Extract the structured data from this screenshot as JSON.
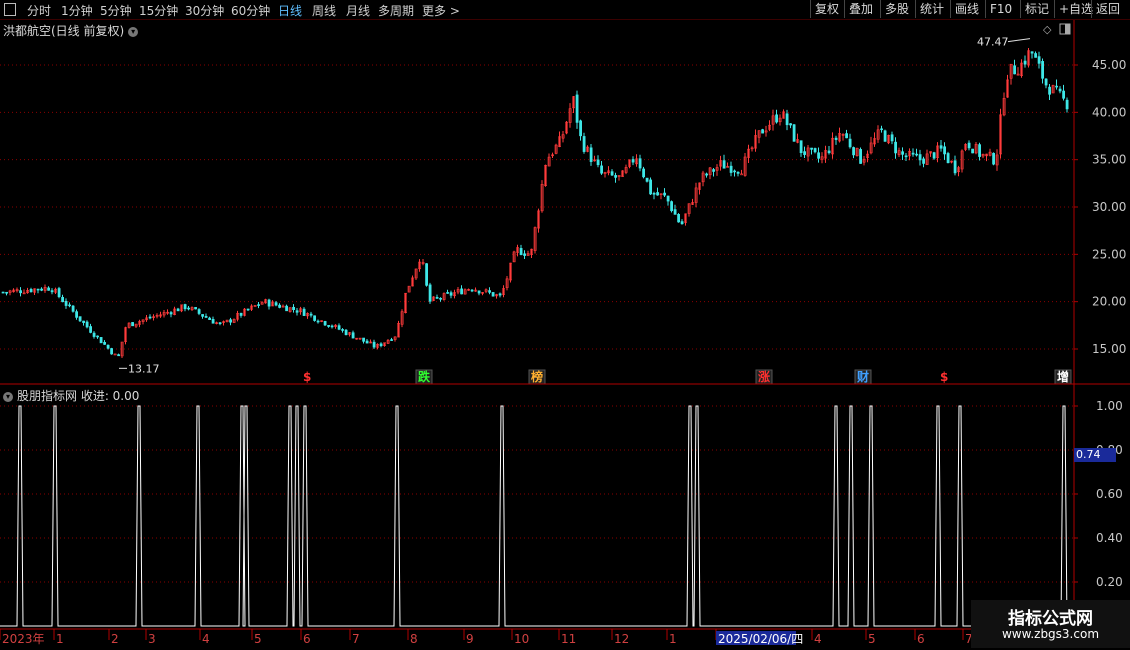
{
  "toolbar": {
    "left_items": [
      "分时",
      "1分钟",
      "5分钟",
      "15分钟",
      "30分钟",
      "60分钟",
      "日线",
      "周线",
      "月线",
      "多周期",
      "更多 >"
    ],
    "active_item": "日线",
    "right_items": [
      "复权",
      "叠加",
      "多股",
      "统计",
      "画线",
      "F10",
      "标记",
      "+自选",
      "返回"
    ]
  },
  "stock": {
    "title": "洪都航空(日线 前复权)"
  },
  "price_chart": {
    "high_label": "47.47",
    "low_label": "13.17",
    "y_ticks": [
      "45.00",
      "40.00",
      "35.00",
      "30.00",
      "25.00",
      "20.00",
      "15.00"
    ],
    "events": [
      {
        "label": "$",
        "color": "#ff3030"
      },
      {
        "label": "跌",
        "color": "#30ff30"
      },
      {
        "label": "榜",
        "color": "#ffb030"
      },
      {
        "label": "涨",
        "color": "#ff3030"
      },
      {
        "label": "财",
        "color": "#40a0ff"
      },
      {
        "label": "$",
        "color": "#ff3030"
      },
      {
        "label": "增",
        "color": "#ffffff"
      }
    ]
  },
  "indicator": {
    "title": "股朋指标网 收进: 0.00",
    "y_ticks": [
      "1.00",
      "0.80",
      "0.60",
      "0.40",
      "0.20"
    ],
    "current_value": "0.74"
  },
  "x_axis": {
    "labels": [
      "2023年",
      "1",
      "2",
      "3",
      "4",
      "5",
      "6",
      "7",
      "8",
      "9",
      "10",
      "11",
      "12",
      "1",
      "2025/02/06/四",
      "4",
      "5",
      "6",
      "7"
    ]
  },
  "watermark": {
    "line1": "指标公式网",
    "line2": "www.zbgs3.com"
  },
  "colors": {
    "up": "#ff3b3b",
    "down": "#3ee6e6",
    "grid": "#8a0000",
    "axis": "#b00000"
  }
}
